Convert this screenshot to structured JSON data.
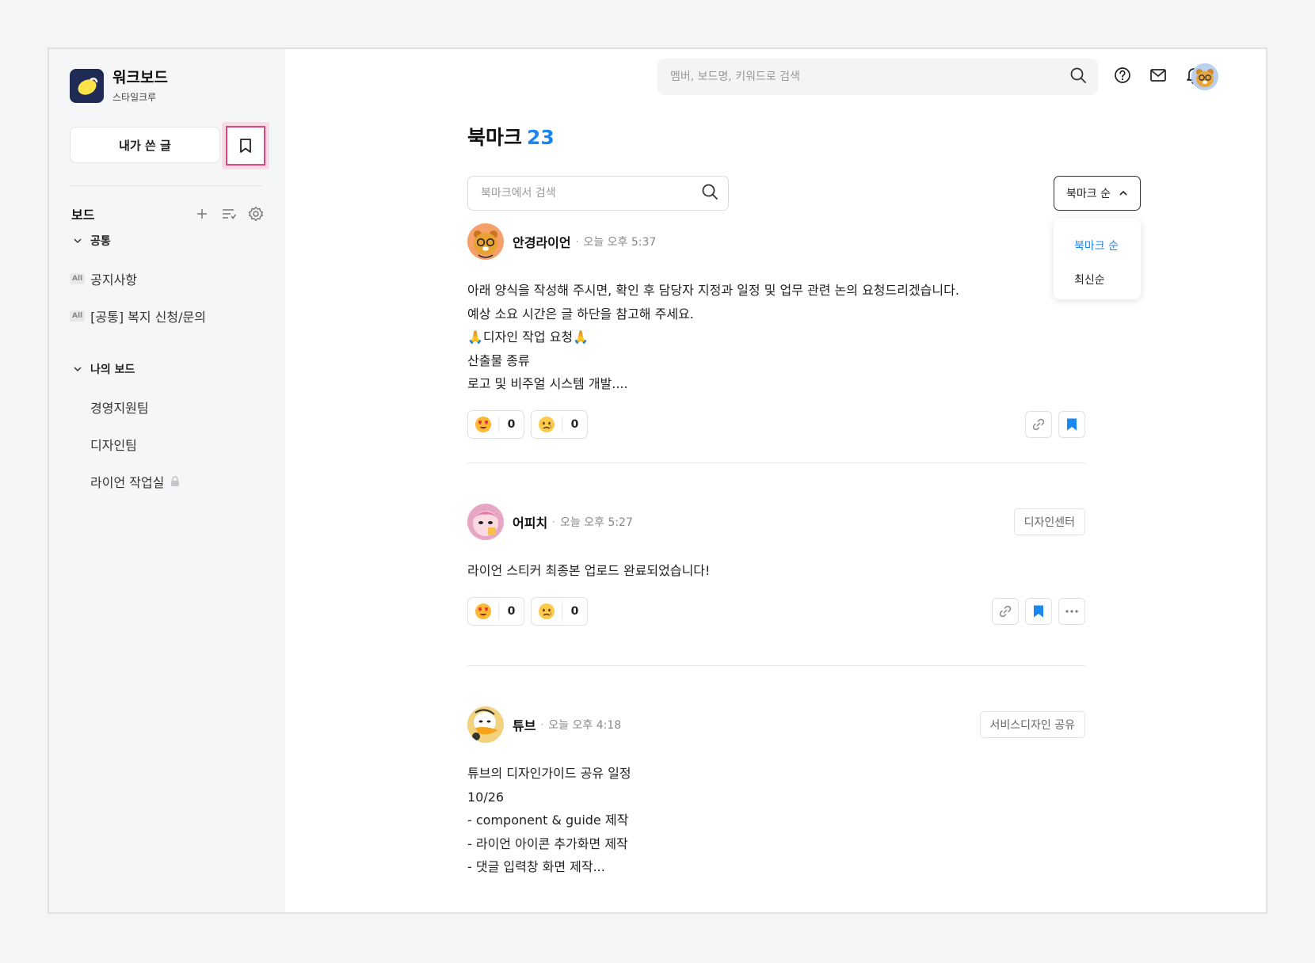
{
  "brand": {
    "name": "워크보드",
    "subtitle": "스타일크루"
  },
  "sidebar": {
    "my_posts_label": "내가 쓴 글",
    "board_title": "보드",
    "group_common": "공통",
    "group_mine": "나의 보드",
    "common_items": [
      {
        "badge": "All",
        "label": "공지사항"
      },
      {
        "badge": "All",
        "label": "[공통] 복지 신청/문의"
      }
    ],
    "my_items": [
      {
        "label": "경영지원팀"
      },
      {
        "label": "디자인팀"
      },
      {
        "label": "라이언 작업실",
        "locked": true
      }
    ]
  },
  "header": {
    "search_placeholder": "멤버, 보드명, 키워드로 검색",
    "icons": [
      "help-icon",
      "mail-icon",
      "bell-icon"
    ]
  },
  "page": {
    "title": "북마크",
    "count": "23",
    "search_placeholder": "북마크에서 검색",
    "sort_label": "북마크 순",
    "sort_options": [
      {
        "label": "북마크 순",
        "active": true
      },
      {
        "label": "최신순",
        "active": false
      }
    ]
  },
  "colors": {
    "accent": "#1a86f0",
    "highlight": "#e0457a",
    "brand_bg": "#1f2a55"
  },
  "posts": [
    {
      "author": "안경라이언",
      "dot": "·",
      "time": "오늘 오후 5:37",
      "lines": [
        "아래 양식을 작성해 주시면, 확인 후 담당자 지정과 일정 및 업무 관련 논의 요청드리겠습니다.",
        "예상 소요 시간은 글 하단을 참고해 주세요.",
        "🙏디자인 작업 요청🙏",
        "산출물 종류",
        "로고 및 비주얼 시스템 개발...."
      ],
      "reactions": [
        {
          "emoji": "heart-eyes",
          "count": "0"
        },
        {
          "emoji": "sad",
          "count": "0"
        }
      ]
    },
    {
      "author": "어피치",
      "dot": "·",
      "time": "오늘 오후 5:27",
      "tag": "디자인센터",
      "lines": [
        "라이언 스티커 최종본 업로드 완료되었습니다!"
      ],
      "reactions": [
        {
          "emoji": "heart-eyes",
          "count": "0"
        },
        {
          "emoji": "sad",
          "count": "0"
        }
      ]
    },
    {
      "author": "튜브",
      "dot": "·",
      "time": "오늘 오후 4:18",
      "tag": "서비스디자인 공유",
      "lines": [
        "튜브의 디자인가이드 공유 일정",
        "10/26",
        "- component & guide 제작",
        "- 라이언 아이콘 추가화면 제작",
        "- 댓글 입력창 화면 제작..."
      ]
    }
  ]
}
